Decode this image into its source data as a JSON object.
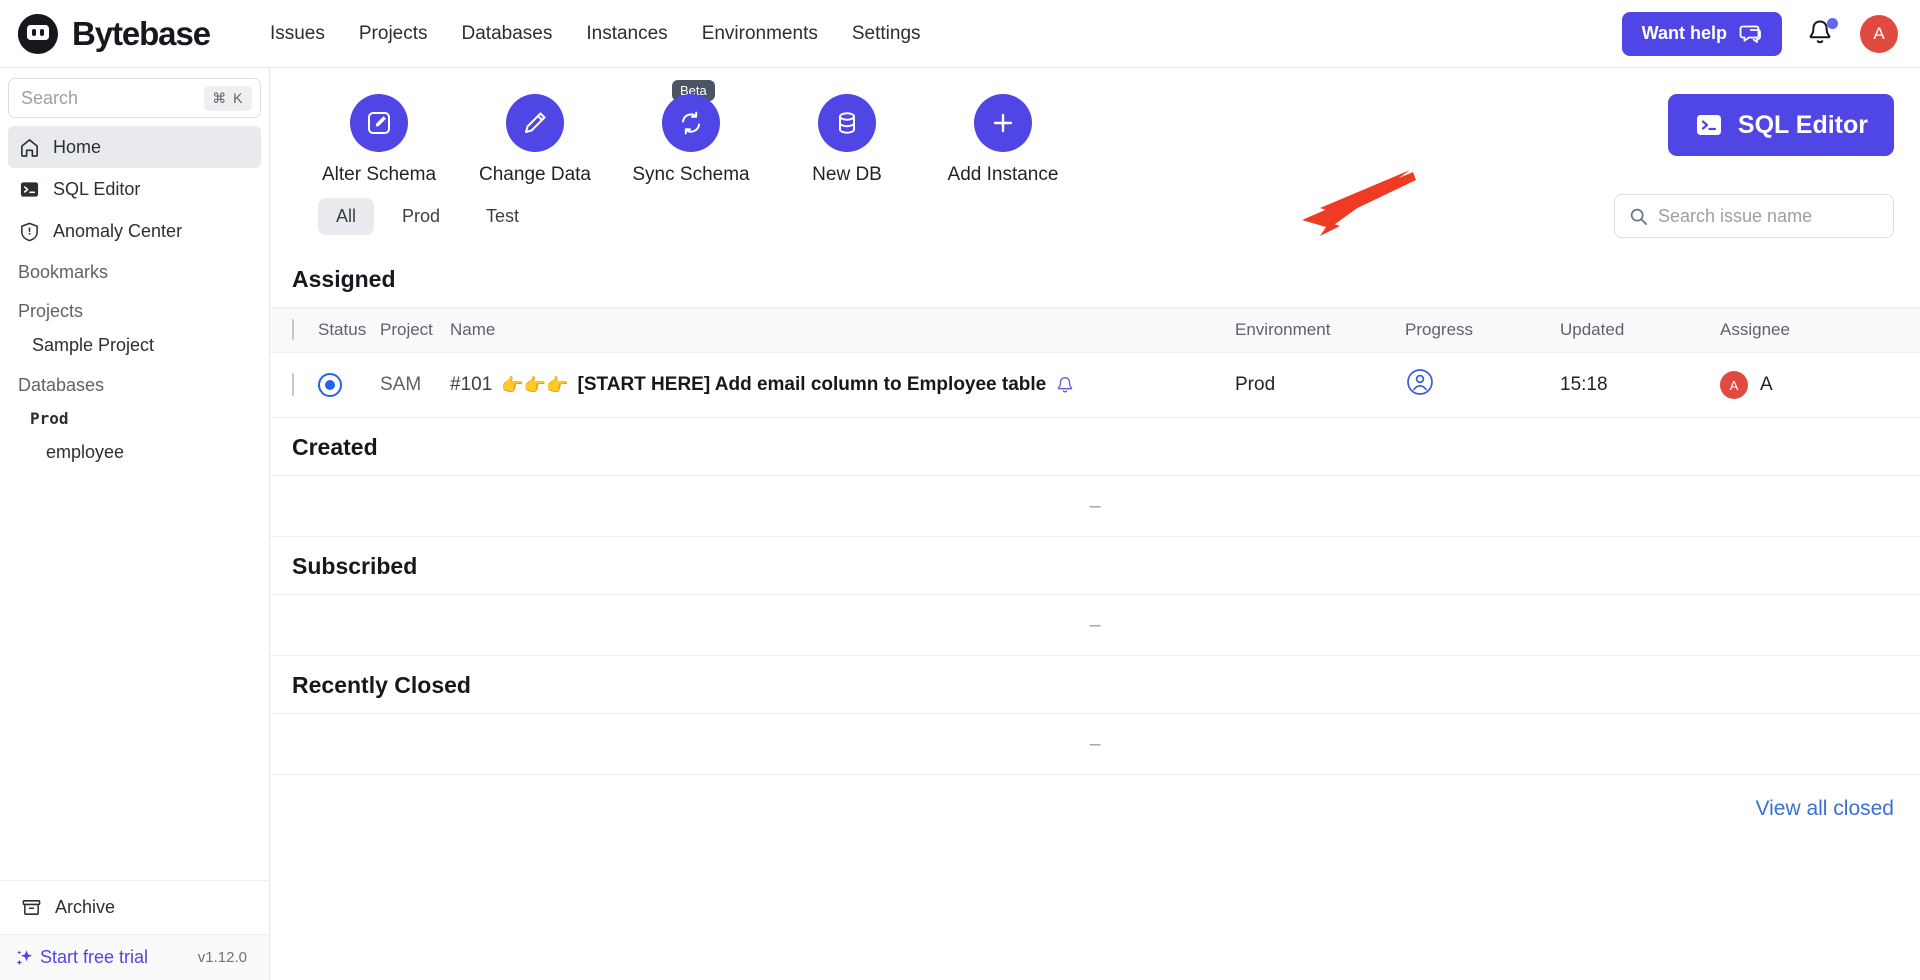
{
  "app": {
    "brand_name": "Bytebase",
    "logo_icon": "bytebase-logo-icon"
  },
  "topnav": {
    "items": [
      {
        "label": "Issues"
      },
      {
        "label": "Projects"
      },
      {
        "label": "Databases"
      },
      {
        "label": "Instances"
      },
      {
        "label": "Environments"
      },
      {
        "label": "Settings"
      }
    ],
    "help_button": {
      "label": "Want help",
      "icon": "chat-bubble-icon"
    },
    "notifications_icon": "bell-icon",
    "avatar_initial": "A"
  },
  "sidebar": {
    "search": {
      "placeholder": "Search",
      "shortcut": "⌘ K",
      "icon": "search-icon"
    },
    "nav": [
      {
        "label": "Home",
        "icon": "home-icon",
        "active": true
      },
      {
        "label": "SQL Editor",
        "icon": "terminal-icon",
        "active": false
      },
      {
        "label": "Anomaly Center",
        "icon": "shield-alert-icon",
        "active": false
      }
    ],
    "bookmarks_label": "Bookmarks",
    "projects_label": "Projects",
    "projects": [
      {
        "label": "Sample Project"
      }
    ],
    "databases_label": "Databases",
    "databases": [
      {
        "label": "Prod",
        "kind": "environment"
      },
      {
        "label": "employee",
        "kind": "database"
      }
    ],
    "archive": {
      "label": "Archive",
      "icon": "archive-box-icon"
    },
    "trial": {
      "label": "Start free trial",
      "icon": "sparkles-icon"
    },
    "version": "v1.12.0"
  },
  "quick_actions": [
    {
      "label": "Alter Schema",
      "icon": "square-pen-icon",
      "badge": ""
    },
    {
      "label": "Change Data",
      "icon": "pencil-icon",
      "badge": ""
    },
    {
      "label": "Sync Schema",
      "icon": "refresh-sync-icon",
      "badge": "Beta"
    },
    {
      "label": "New DB",
      "icon": "database-icon",
      "badge": ""
    },
    {
      "label": "Add Instance",
      "icon": "plus-icon",
      "badge": ""
    }
  ],
  "sql_editor_button": {
    "label": "SQL Editor",
    "icon": "terminal-icon"
  },
  "annotation": {
    "type": "red-arrow",
    "points_to": "Add Instance",
    "color": "#ef3b23"
  },
  "filters": {
    "tabs": [
      {
        "label": "All",
        "active": true
      },
      {
        "label": "Prod",
        "active": false
      },
      {
        "label": "Test",
        "active": false
      }
    ],
    "search": {
      "placeholder": "Search issue name",
      "value": "",
      "icon": "search-icon"
    }
  },
  "issue_table": {
    "columns": [
      "Status",
      "Project",
      "Name",
      "Environment",
      "Progress",
      "Updated",
      "Assignee"
    ],
    "empty_placeholder": "–"
  },
  "sections": [
    {
      "title": "Assigned",
      "rows": [
        {
          "status_icon": "open-circle-icon",
          "project": "SAM",
          "issue_id": "#101",
          "emoji": "👉👉👉",
          "name": "[START HERE] Add email column to Employee table",
          "subscribed_icon": "bell-icon",
          "environment": "Prod",
          "progress_icon": "person-circle-icon",
          "updated": "15:18",
          "assignee_initial": "A",
          "assignee": "A"
        }
      ]
    },
    {
      "title": "Created",
      "rows": []
    },
    {
      "title": "Subscribed",
      "rows": []
    },
    {
      "title": "Recently Closed",
      "rows": []
    }
  ],
  "footer_link": {
    "label": "View all closed"
  },
  "colors": {
    "brand_primary": "#4f46e5",
    "accent_red": "#e04a3f",
    "annotation_red": "#ef3b23",
    "link_blue": "#3b6fd4",
    "status_blue": "#2563eb"
  }
}
